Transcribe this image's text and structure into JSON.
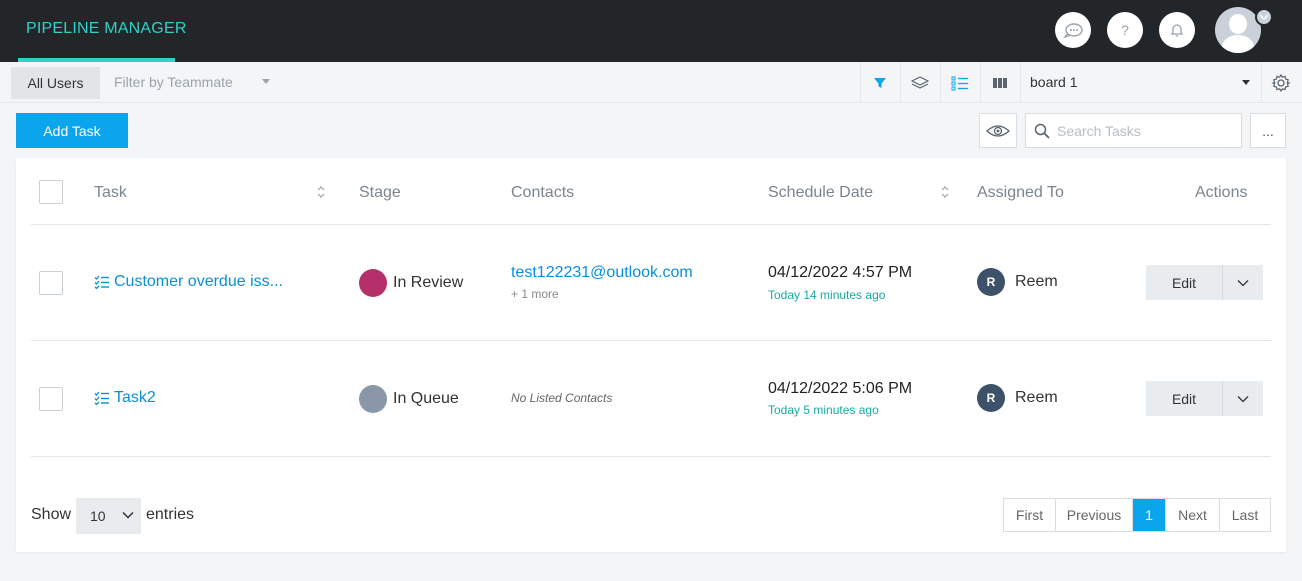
{
  "header": {
    "brand": "PIPELINE MANAGER",
    "help_glyph": "?",
    "icons": [
      "chat-icon",
      "help-icon",
      "bell-icon",
      "avatar",
      "chevron-down-icon"
    ]
  },
  "toolbar": {
    "tab_all_users": "All Users",
    "filter_placeholder": "Filter by Teammate",
    "board_value": "board 1",
    "icons": [
      "filter-icon",
      "layers-icon",
      "list-view-icon",
      "board-view-icon",
      "settings-icon"
    ]
  },
  "actions": {
    "add_task": "Add Task",
    "search_placeholder": "Search Tasks",
    "more": "..."
  },
  "table": {
    "headers": {
      "task": "Task",
      "stage": "Stage",
      "contacts": "Contacts",
      "schedule": "Schedule Date",
      "assigned": "Assigned To",
      "actions": "Actions"
    },
    "rows": [
      {
        "task": "Customer overdue iss...",
        "stage": "In Review",
        "stage_color": "#b5306a",
        "contact": "test122231@outlook.com",
        "contact_more": "+ 1 more",
        "date": "04/12/2022 4:57 PM",
        "relative": "Today 14 minutes ago",
        "assignee_initial": "R",
        "assignee": "Reem",
        "edit": "Edit"
      },
      {
        "task": "Task2",
        "stage": "In Queue",
        "stage_color": "#8a97a8",
        "contact_none": "No Listed Contacts",
        "date": "04/12/2022 5:06 PM",
        "relative": "Today 5 minutes ago",
        "assignee_initial": "R",
        "assignee": "Reem",
        "edit": "Edit"
      }
    ]
  },
  "footer": {
    "show": "Show",
    "entries_value": "10",
    "entries": "entries",
    "pager": {
      "first": "First",
      "previous": "Previous",
      "current": "1",
      "next": "Next",
      "last": "Last"
    }
  },
  "colors": {
    "accent": "#0aa5ec",
    "brand": "#2fd2c8",
    "link": "#0a8fd6",
    "relative_time": "#19a9a0"
  }
}
